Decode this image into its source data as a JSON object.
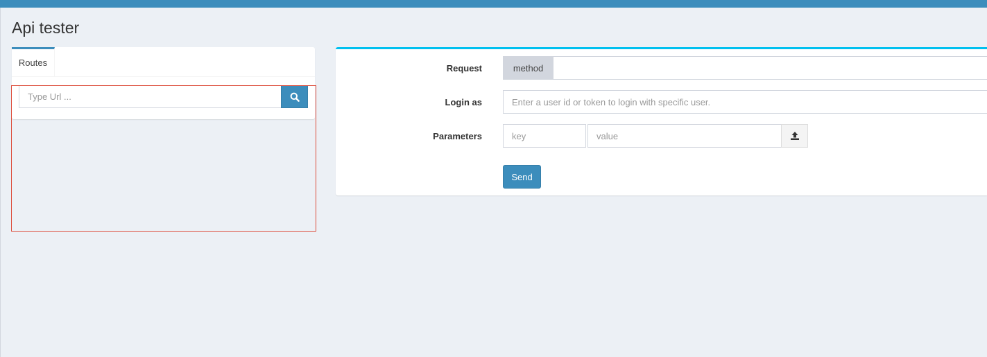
{
  "header": {
    "title": "Api tester",
    "bar_color": "#3c8dbc"
  },
  "routes_panel": {
    "tab_label": "Routes",
    "search": {
      "placeholder": "Type Url ...",
      "value": "",
      "icon": "search-icon"
    }
  },
  "request_panel": {
    "accent_color": "#00c0ef",
    "request": {
      "label": "Request",
      "method_label": "method",
      "value": ""
    },
    "login": {
      "label": "Login as",
      "placeholder": "Enter a user id or token to login with specific user.",
      "value": ""
    },
    "parameters": {
      "label": "Parameters",
      "key_placeholder": "key",
      "value_placeholder": "value",
      "upload_icon": "upload-icon"
    },
    "send_label": "Send"
  },
  "highlight_color": "#dd4b39"
}
